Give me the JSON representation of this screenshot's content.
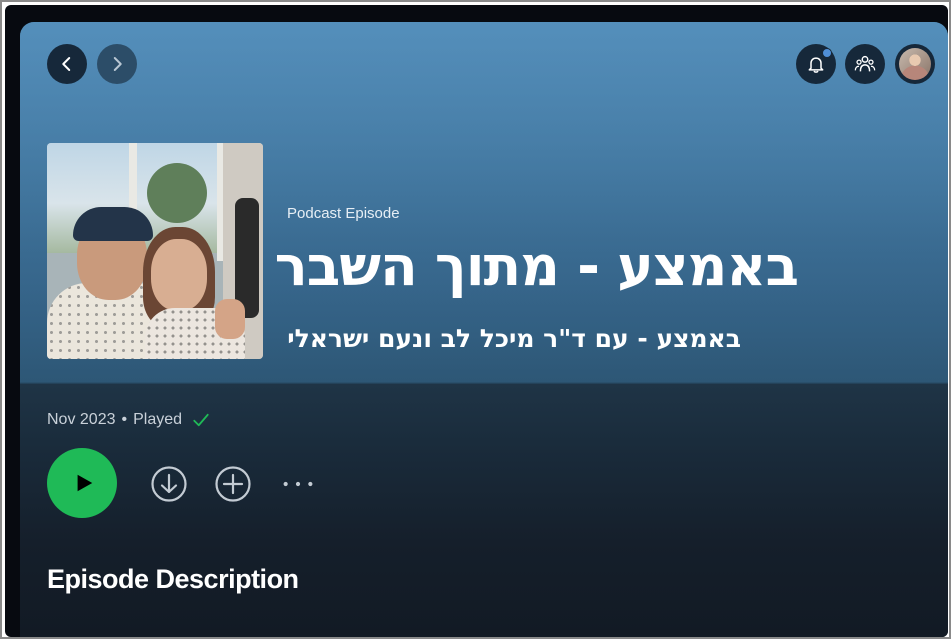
{
  "header": {
    "back_icon": "chevron-left-icon",
    "forward_icon": "chevron-right-icon",
    "notifications_icon": "bell-icon",
    "friends_icon": "friends-icon",
    "profile_icon": "avatar"
  },
  "episode": {
    "type_label": "Podcast Episode",
    "title": "באמצע - מתוך השבר",
    "show_name": "באמצע - עם ד\"ר מיכל לב ונעם ישראלי",
    "date": "Nov 2023",
    "separator": "•",
    "status": "Played"
  },
  "actions": {
    "play_icon": "play-icon",
    "download_icon": "download-circle-icon",
    "add_icon": "add-circle-icon",
    "more_label": "···"
  },
  "section": {
    "description_heading": "Episode Description"
  },
  "colors": {
    "accent_green": "#1fba57",
    "header_blue": "#4d86b0",
    "background_dark": "#121a24"
  }
}
